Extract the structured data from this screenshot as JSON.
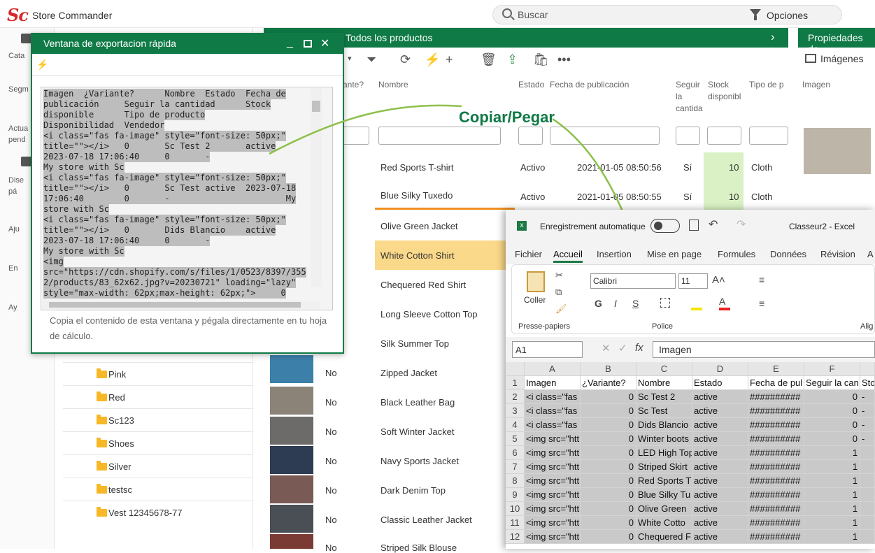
{
  "app": {
    "logo_s": "S",
    "logo_c": "c",
    "title": "Store Commander"
  },
  "topbar": {
    "search_placeholder": "Buscar",
    "options_label": "Opciones"
  },
  "leftnav": {
    "items": [
      "Cata",
      "Segm",
      "Actua",
      "pend",
      "Dise",
      "pá",
      "Aju",
      "En",
      "Ay"
    ]
  },
  "tree": {
    "items": [
      "Pink",
      "Red",
      "Sc123",
      "Shoes",
      "Silver",
      "testsc",
      "Vest 12345678-77"
    ]
  },
  "products": {
    "header": "Todos los productos",
    "columns": {
      "variante": "ante?",
      "nombre": "Nombre",
      "estado": "Estado",
      "fecha": "Fecha de publicación",
      "seguir": "Seguir la cantida",
      "stock": "Stock disponibl",
      "tipo": "Tipo de p"
    },
    "top_rows": [
      {
        "name": "Red Sports T-shirt",
        "estado": "Activo",
        "fecha": "2021-01-05 08:50:56",
        "seguir": "Sí",
        "stock": "10",
        "tipo": "Cloth"
      },
      {
        "name": "Blue Silky Tuxedo",
        "estado": "Activo",
        "fecha": "2021-01-05 08:50:55",
        "seguir": "Sí",
        "stock": "10",
        "tipo": "Cloth"
      }
    ],
    "names": [
      "Olive Green Jacket",
      "White Cotton Shirt",
      "Chequered Red Shirt",
      "Long Sleeve Cotton Top",
      "Silk Summer Top",
      "Zipped Jacket",
      "Black Leather Bag",
      "Soft Winter Jacket",
      "Navy Sports Jacket",
      "Dark Denim Top",
      "Classic Leather Jacket",
      "Striped Silk Blouse"
    ],
    "no_label": "No"
  },
  "props": {
    "header": "Propiedades de",
    "tab": "Imágenes",
    "col": "Imagen"
  },
  "dialog": {
    "title": "Ventana de exportacion rápida",
    "lines": [
      "Imagen  ¿Variante?      Nombre  Estado  Fecha de",
      "publicación     Seguir la cantidad      Stock",
      "disponible      Tipo de producto",
      "Disponibilidad  Vendedor",
      "<i class=\"fas fa-image\" style=\"font-size: 50px;\"",
      "title=\"\"></i>   0       Sc Test 2       active",
      "2023-07-18 17:06:40     0       -",
      "My store with Sc",
      "<i class=\"fas fa-image\" style=\"font-size: 50px;\"",
      "title=\"\"></i>   0       Sc Test active  2023-07-18",
      "17:06:40        0       -                       My",
      "store with Sc",
      "<i class=\"fas fa-image\" style=\"font-size: 50px;\"",
      "title=\"\"></i>   0       Dids Blancio    active",
      "2023-07-18 17:06:40     0       -",
      "My store with Sc",
      "<img",
      "src=\"https://cdn.shopify.com/s/files/1/0523/8397/355",
      "2/products/83_62x62.jpg?v=20230721\" loading=\"lazy\"",
      "style=\"max-width: 62px;max-height: 62px;\">     0"
    ],
    "note": "Copia el contenido de esta ventana y pégala directamente en tu hoja de cálculo."
  },
  "callout": "Copiar/Pegar",
  "excel": {
    "autosave": "Enregistrement automatique",
    "doc": "Classeur2 - Excel",
    "tabs": [
      "Fichier",
      "Accueil",
      "Insertion",
      "Mise en page",
      "Formules",
      "Données",
      "Révision",
      "A"
    ],
    "paste": "Coller",
    "clipboard": "Presse-papiers",
    "font_name": "Calibri",
    "font_size": "11",
    "police": "Police",
    "align": "Alig",
    "namebox": "A1",
    "formula": "Imagen",
    "cols": [
      "A",
      "B",
      "C",
      "D",
      "E",
      "F"
    ],
    "rows": [
      [
        "Imagen",
        "¿Variante?",
        "Nombre",
        "Estado",
        "Fecha de pul",
        "Seguir la can",
        "Sto"
      ],
      [
        "<i class=\"fas",
        "0",
        "Sc Test 2",
        "active",
        "##########",
        "0",
        "-"
      ],
      [
        "<i class=\"fas",
        "0",
        "Sc Test",
        "active",
        "##########",
        "0",
        "-"
      ],
      [
        "<i class=\"fas",
        "0",
        "Dids Blancio",
        "active",
        "##########",
        "0",
        "-"
      ],
      [
        "<img src=\"htt",
        "0",
        "Winter boots",
        "active",
        "##########",
        "0",
        "-"
      ],
      [
        "<img src=\"htt",
        "0",
        "LED High Top",
        "active",
        "##########",
        "1",
        ""
      ],
      [
        "<img src=\"htt",
        "0",
        "Striped Skirt",
        "active",
        "##########",
        "1",
        ""
      ],
      [
        "<img src=\"htt",
        "0",
        "Red Sports T",
        "active",
        "##########",
        "1",
        ""
      ],
      [
        "<img src=\"htt",
        "0",
        "Blue Silky Tu",
        "active",
        "##########",
        "1",
        ""
      ],
      [
        "<img src=\"htt",
        "0",
        "Olive Green",
        "active",
        "##########",
        "1",
        ""
      ],
      [
        "<img src=\"htt",
        "0",
        "White Cotto",
        "active",
        "##########",
        "1",
        ""
      ],
      [
        "<img src=\"htt",
        "0",
        "Chequered F",
        "active",
        "##########",
        "1",
        ""
      ]
    ]
  }
}
